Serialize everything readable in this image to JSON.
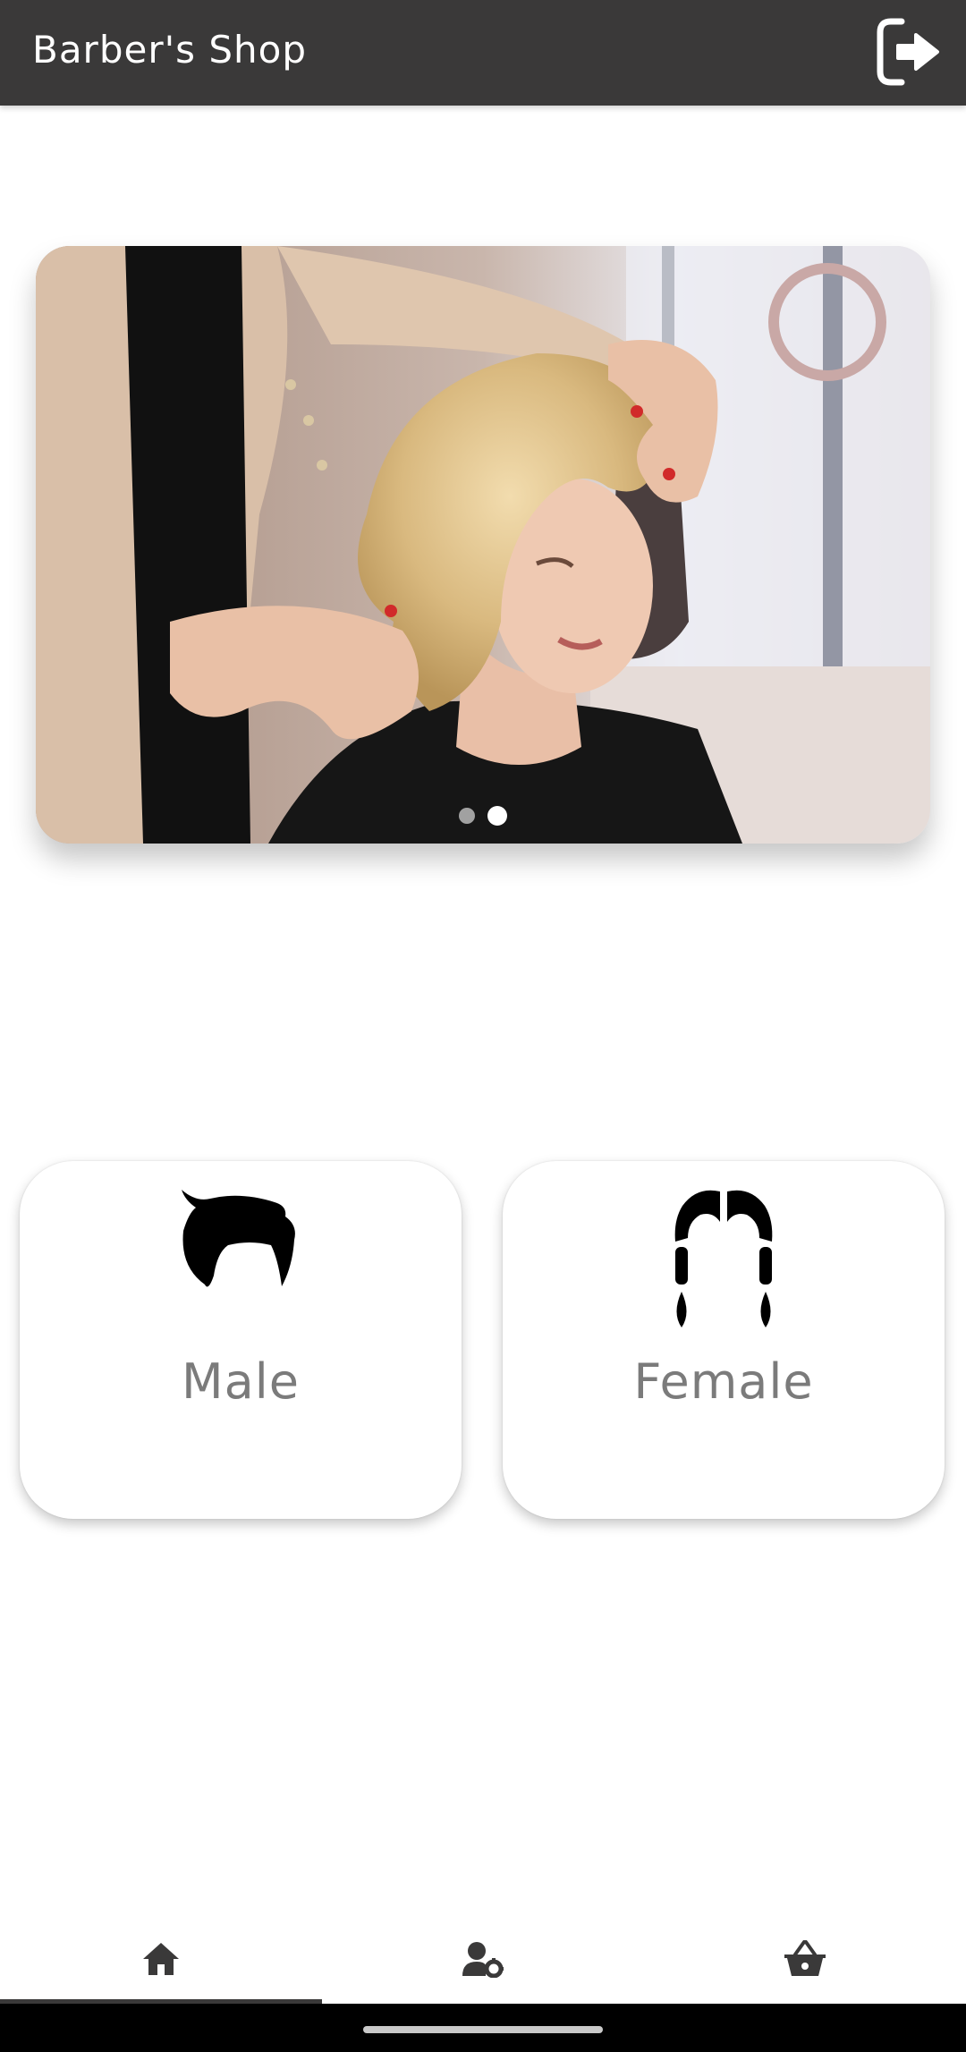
{
  "appbar": {
    "title": "Barber's Shop",
    "logout_icon": "logout-icon"
  },
  "carousel": {
    "photo": "hairdresser-styling-blonde-client",
    "pages": 2,
    "active_page": 2
  },
  "categories": [
    {
      "label": "Male",
      "icon": "male-hair-icon"
    },
    {
      "label": "Female",
      "icon": "female-hair-icon"
    }
  ],
  "bottom_nav": {
    "items": [
      {
        "icon": "home-icon"
      },
      {
        "icon": "user-settings-icon"
      },
      {
        "icon": "basket-icon"
      }
    ],
    "selected": 0
  },
  "colors": {
    "appbar": "#3a3939",
    "label_text": "#7b7b7b",
    "nav_icon": "#3a3939"
  }
}
